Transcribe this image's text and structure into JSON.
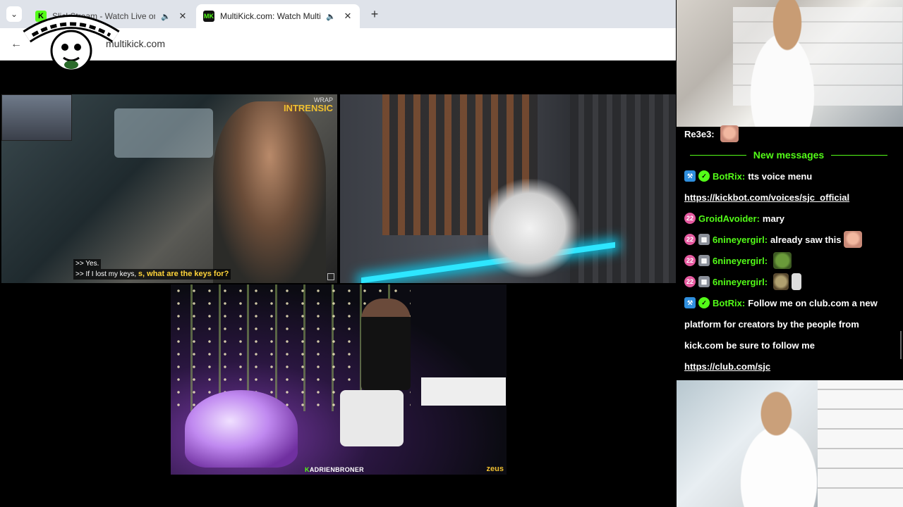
{
  "browser": {
    "tabs": [
      {
        "title": "SlickStream - Watch Live on",
        "active": false,
        "favicon": "K"
      },
      {
        "title": "MultiKick.com: Watch Multiple",
        "active": true,
        "favicon": "MK"
      }
    ],
    "url": "multikick.com"
  },
  "streams": {
    "stream1": {
      "brand_top": "WRAP",
      "brand_bottom": "INTRENSIC",
      "subtitle_line1": ">> Yes.",
      "subtitle_line2": ">> If I lost my keys,",
      "subtitle_highlight": "s, what are the keys for?"
    },
    "stream3": {
      "watermark_prefix": "K",
      "watermark": "ADRIENBRONER",
      "network": "zeus"
    }
  },
  "chat": {
    "top_user": "Re3e3:",
    "new_messages_label": "New messages",
    "messages": [
      {
        "user": "BotRix:",
        "text": "tts voice menu"
      },
      {
        "link": "https://kickbot.com/voices/sjc_official"
      },
      {
        "user": "GroidAvoider:",
        "text": "mary"
      },
      {
        "user": "6nineyergirl:",
        "text": "already saw this"
      },
      {
        "user": "6nineyergirl:",
        "text": ""
      },
      {
        "user": "6nineyergirl:",
        "text": ""
      },
      {
        "user": "BotRix:",
        "text": "Follow me on club.com a new"
      },
      {
        "text": "platform for creators by the people from"
      },
      {
        "text": "kick.com be sure to follow me"
      },
      {
        "link": "https://club.com/sjc"
      }
    ]
  },
  "colors": {
    "kick_green": "#53fc18",
    "bot_badge": "#2f8fde",
    "sub_badge": "#e65aa0"
  }
}
